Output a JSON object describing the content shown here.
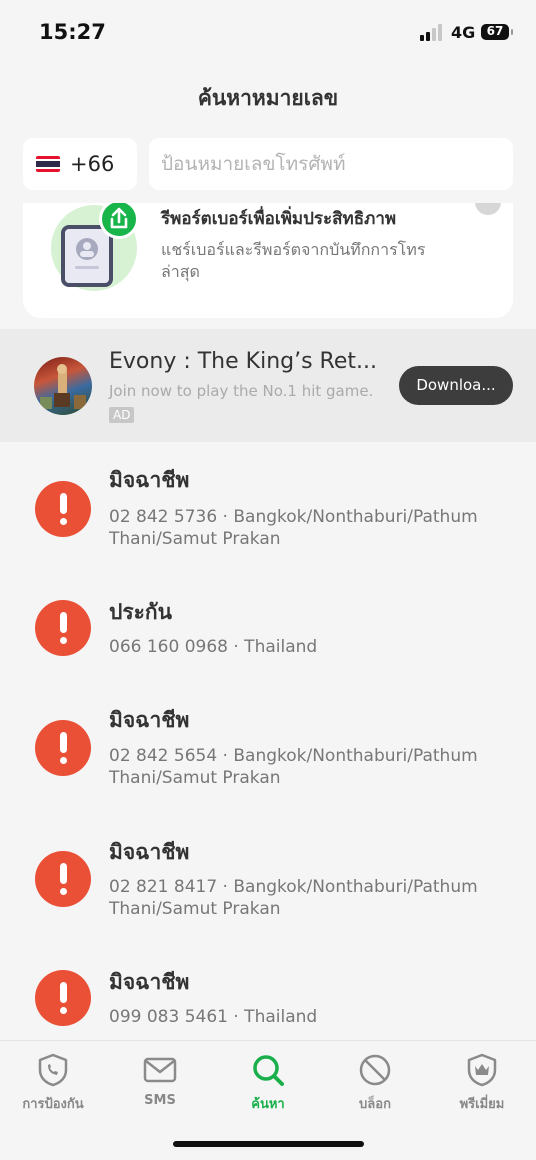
{
  "status_bar": {
    "time": "15:27",
    "network": "4G",
    "battery": "67"
  },
  "header": {
    "title": "ค้นหาหมายเลข"
  },
  "search": {
    "country_code": "+66",
    "placeholder": "ป้อนหมายเลขโทรศัพท์"
  },
  "report_card": {
    "title": "รีพอร์ตเบอร์เพื่อเพิ่มประสิทธิภาพ",
    "description": "แชร์เบอร์และรีพอร์ตจากบันทึกการโทรล่าสุด"
  },
  "ad": {
    "title": "Evony : The King’s Ret...",
    "subtitle": "Join now to play the No.1 hit game.",
    "badge": "AD",
    "button": "Downloa..."
  },
  "results": [
    {
      "label": "มิจฉาชีพ",
      "detail": "02 842 5736 · Bangkok/Nonthaburi/Pathum Thani/Samut Prakan"
    },
    {
      "label": "ประกัน",
      "detail": "066 160 0968 · Thailand"
    },
    {
      "label": "มิจฉาชีพ",
      "detail": "02 842 5654 · Bangkok/Nonthaburi/Pathum Thani/Samut Prakan"
    },
    {
      "label": "มิจฉาชีพ",
      "detail": "02 821 8417 · Bangkok/Nonthaburi/Pathum Thani/Samut Prakan"
    },
    {
      "label": "มิจฉาชีพ",
      "detail": "099 083 5461 · Thailand"
    }
  ],
  "tabs": [
    {
      "label": "การป้องกัน",
      "icon": "shield-phone-icon",
      "active": false
    },
    {
      "label": "SMS",
      "icon": "envelope-icon",
      "active": false
    },
    {
      "label": "ค้นหา",
      "icon": "search-icon",
      "active": true
    },
    {
      "label": "บล็อก",
      "icon": "block-icon",
      "active": false
    },
    {
      "label": "พรีเมี่ยม",
      "icon": "crown-shield-icon",
      "active": false
    }
  ],
  "colors": {
    "accent": "#19b04b",
    "warning": "#ea5036",
    "ad_button": "#3d3d3d"
  }
}
